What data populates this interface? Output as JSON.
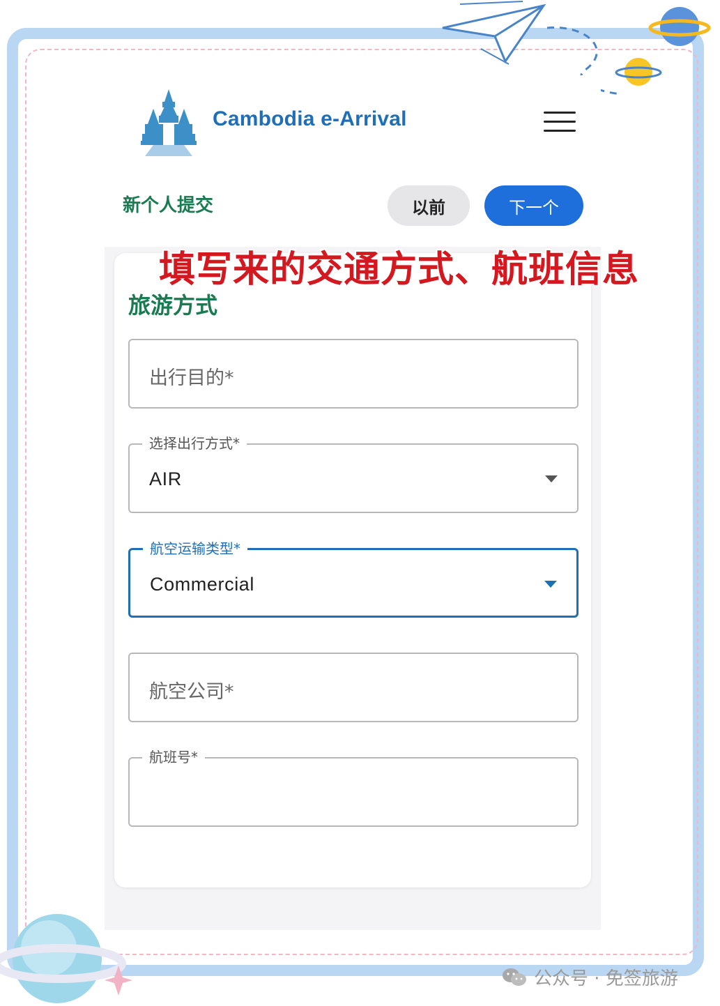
{
  "app": {
    "title": "Cambodia e-Arrival",
    "logo": "angkor-temple-logo",
    "menu_icon": "hamburger-menu-icon"
  },
  "toolbar": {
    "section_label": "新个人提交",
    "prev_label": "以前",
    "next_label": "下一个"
  },
  "form": {
    "section_title": "旅游方式",
    "fields": {
      "purpose": {
        "placeholder": "出行目的*",
        "value": ""
      },
      "travel_mode": {
        "label": "选择出行方式*",
        "value": "AIR"
      },
      "air_transport_type": {
        "label": "航空运输类型*",
        "value": "Commercial"
      },
      "airline": {
        "placeholder": "航空公司*",
        "value": ""
      },
      "flight_number": {
        "label": "航班号*",
        "value": ""
      }
    }
  },
  "annotation": {
    "text": "填写来的交通方式、航班信息"
  },
  "watermark": {
    "text": "公众号 · 免签旅游",
    "icon": "wechat-icon"
  },
  "colors": {
    "brand_blue": "#1f6fb8",
    "primary_button": "#1e6fdc",
    "section_green": "#1a7a52",
    "annotation_red": "#d4181f",
    "frame_blue": "#b9d6f3",
    "frame_dash_pink": "#f1b7c4"
  }
}
